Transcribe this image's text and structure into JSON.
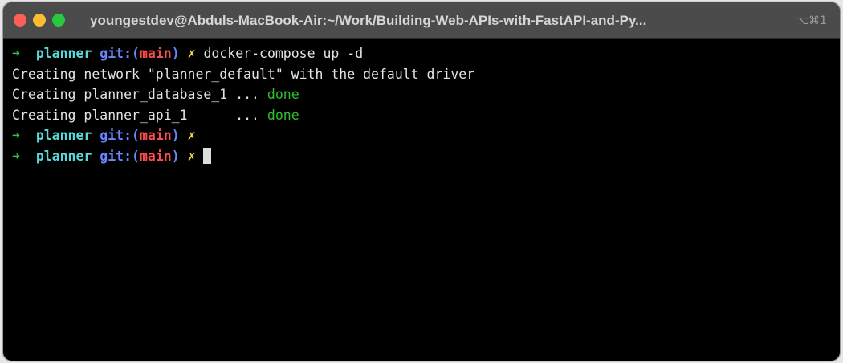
{
  "window": {
    "title": "youngestdev@Abduls-MacBook-Air:~/Work/Building-Web-APIs-with-FastAPI-and-Py...",
    "shortcut": "⌥⌘1",
    "traffic_lights": {
      "close_color": "#ff5f57",
      "minimize_color": "#febc2e",
      "zoom_color": "#28c840"
    }
  },
  "prompt": {
    "arrow": "➜",
    "dir": "planner",
    "git_open": "git:(",
    "branch": "main",
    "git_close": ")",
    "dirty": "✗"
  },
  "output": {
    "command": "docker-compose up -d",
    "line1": "Creating network \"planner_default\" with the default driver",
    "line2_text": "Creating planner_database_1 ... ",
    "line2_status": "done",
    "line3_text": "Creating planner_api_1      ... ",
    "line3_status": "done"
  },
  "colors": {
    "background": "#000000",
    "prompt_arrow": "#35c24a",
    "prompt_dir": "#57d9dc",
    "git": "#6a86ff",
    "branch": "#ff4d4d",
    "dirty": "#ffd93d",
    "done": "#2fbf2f"
  }
}
